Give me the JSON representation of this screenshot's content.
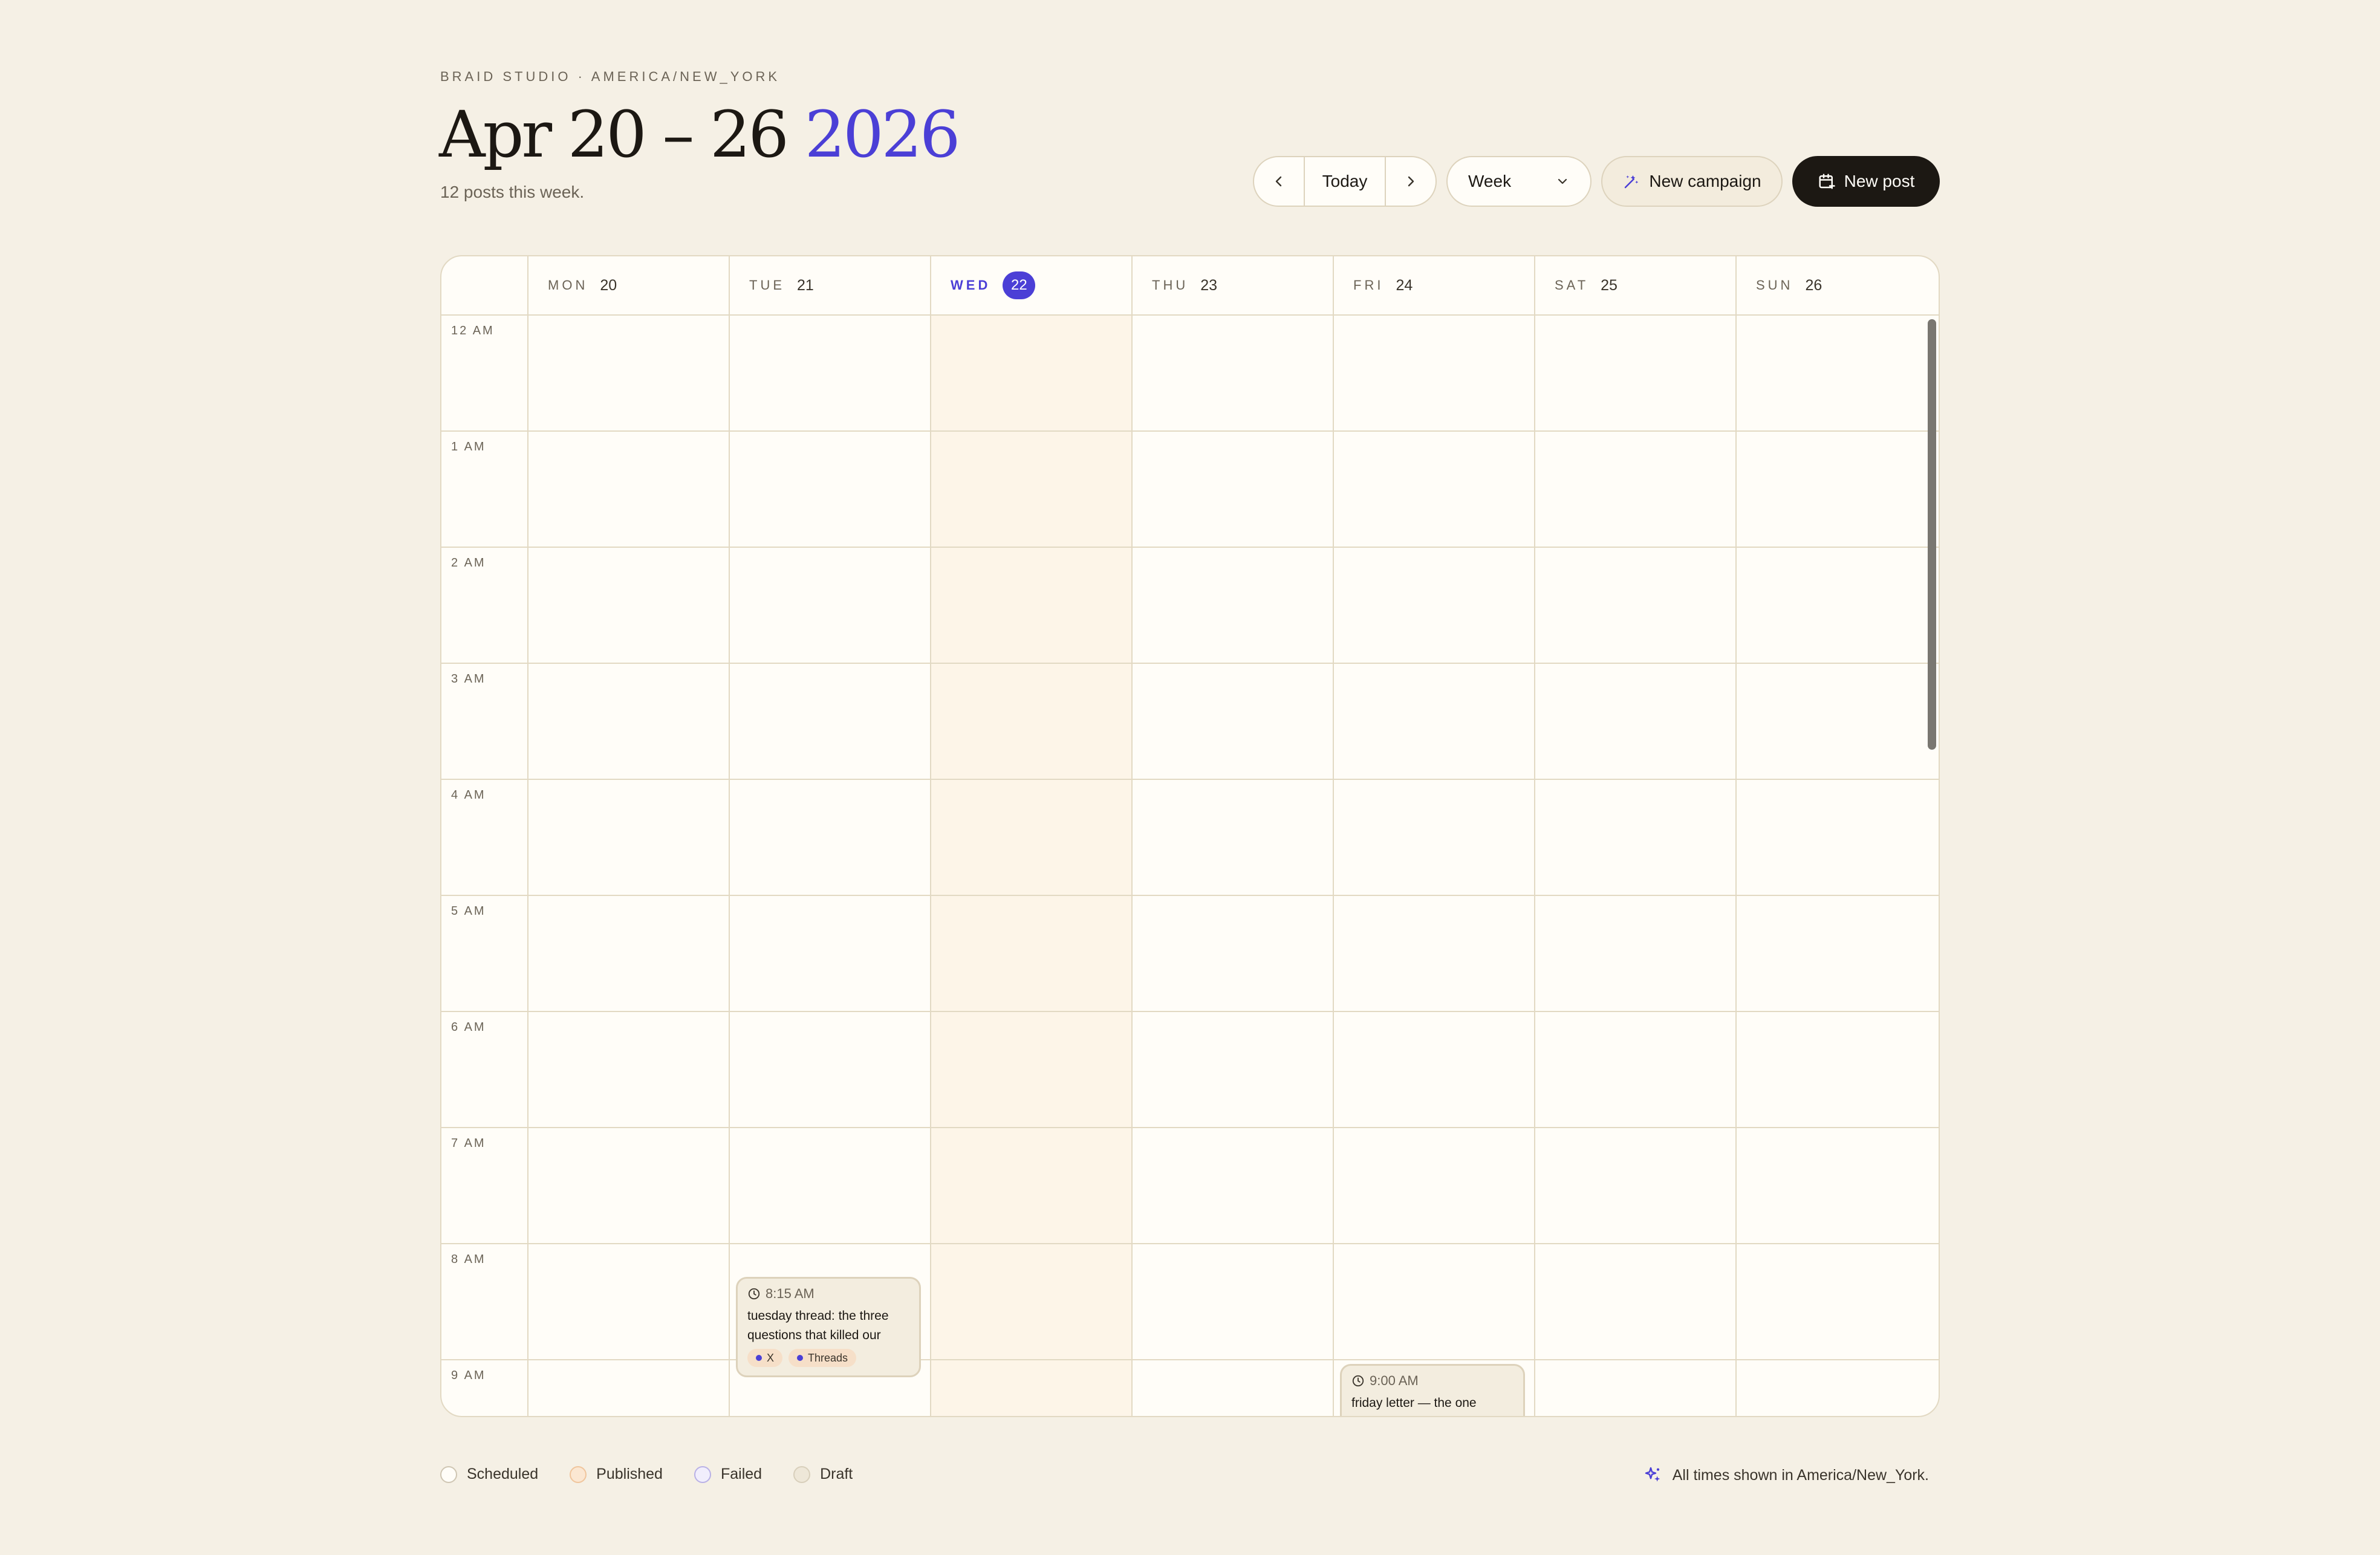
{
  "header": {
    "org_line": "BRAID STUDIO · AMERICA/NEW_YORK",
    "title_range": "Apr 20 – 26",
    "title_year": "2026",
    "subtitle": "12 posts this week."
  },
  "toolbar": {
    "prev_icon": "chevron-left-icon",
    "today_label": "Today",
    "next_icon": "chevron-right-icon",
    "view_value": "Week",
    "new_campaign_label": "New campaign",
    "new_post_label": "New post"
  },
  "calendar": {
    "days": [
      {
        "dow": "MON",
        "num": "20",
        "today": false
      },
      {
        "dow": "TUE",
        "num": "21",
        "today": false
      },
      {
        "dow": "WED",
        "num": "22",
        "today": true
      },
      {
        "dow": "THU",
        "num": "23",
        "today": false
      },
      {
        "dow": "FRI",
        "num": "24",
        "today": false
      },
      {
        "dow": "SAT",
        "num": "25",
        "today": false
      },
      {
        "dow": "SUN",
        "num": "26",
        "today": false
      }
    ],
    "hours": [
      "12 AM",
      "1 AM",
      "2 AM",
      "3 AM",
      "4 AM",
      "5 AM",
      "6 AM",
      "7 AM",
      "8 AM",
      "9 AM"
    ],
    "posts": [
      {
        "day_index": 1,
        "time": "8:15 AM",
        "start_hour": 8.25,
        "text": "tuesday thread: the three questions that killed our",
        "channels": [
          "X",
          "Threads"
        ]
      },
      {
        "day_index": 4,
        "time": "9:00 AM",
        "start_hour": 9.0,
        "text": "friday letter — the one",
        "channels": []
      }
    ]
  },
  "legend": [
    {
      "label": "Scheduled",
      "color": "#fffdf8",
      "border": "#cfc6b3"
    },
    {
      "label": "Published",
      "color": "#fbe7d2",
      "border": "#f0c59c"
    },
    {
      "label": "Failed",
      "color": "#f1eefc",
      "border": "#b9b1e6"
    },
    {
      "label": "Draft",
      "color": "#eee7d8",
      "border": "#d8cfbb"
    }
  ],
  "footnote": "All times shown in America/New_York.",
  "colors": {
    "accent": "#4b3fd6",
    "background": "#f5f0e5",
    "today_column": "#fdf5e8"
  }
}
